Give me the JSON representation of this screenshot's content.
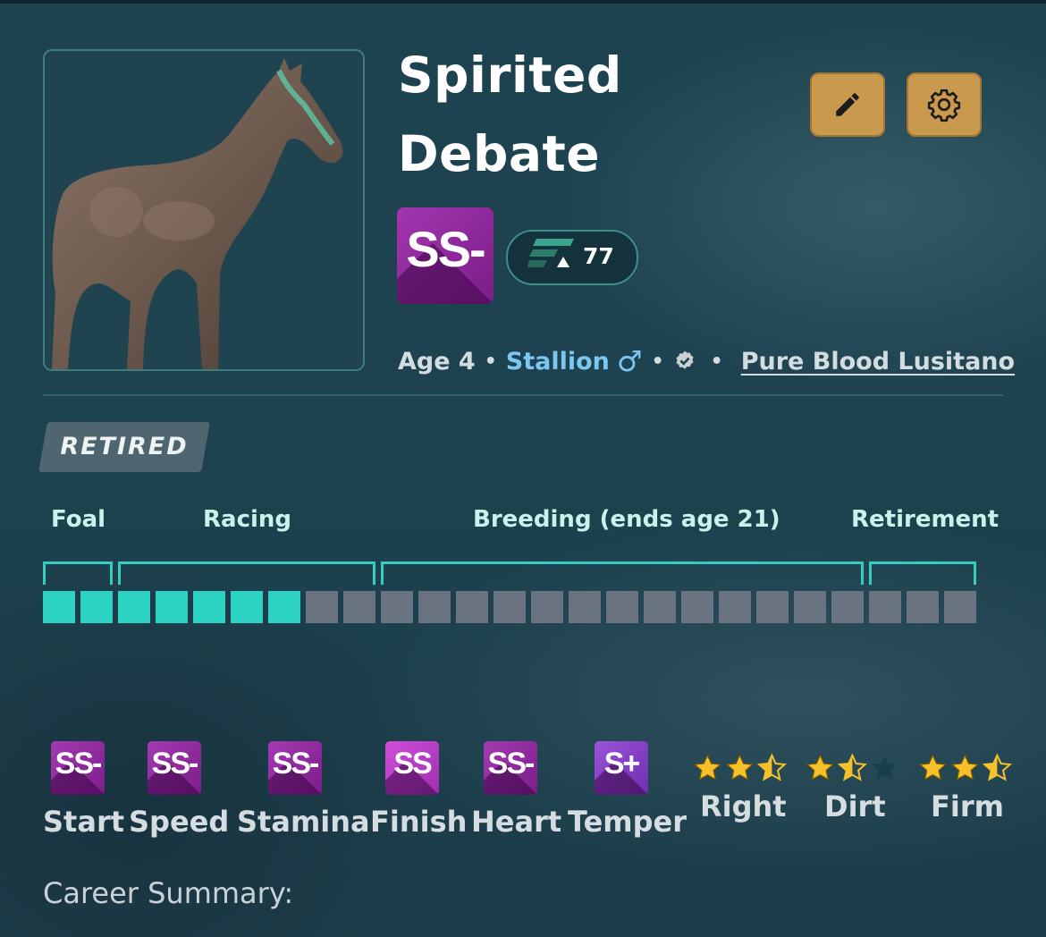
{
  "horse": {
    "name_line1": "Spirited",
    "name_line2": "Debate",
    "grade": "SS-",
    "rating": "77",
    "age": "Age 4",
    "sex": "Stallion",
    "sex_symbol": "♂",
    "breed": "Pure Blood Lusitano",
    "status": "RETIRED"
  },
  "actions": {
    "edit_icon": "pencil-icon",
    "settings_icon": "gear-icon"
  },
  "lifecycle": {
    "phases": [
      "Foal",
      "Racing",
      "Breeding (ends age 21)",
      "Retirement"
    ],
    "total_years": 25,
    "elapsed_years": 7
  },
  "stats": [
    {
      "label": "Start",
      "grade": "SS-"
    },
    {
      "label": "Speed",
      "grade": "SS-"
    },
    {
      "label": "Stamina",
      "grade": "SS-"
    },
    {
      "label": "Finish",
      "grade": "SS"
    },
    {
      "label": "Heart",
      "grade": "SS-"
    },
    {
      "label": "Temper",
      "grade": "S+"
    }
  ],
  "preferences": [
    {
      "label": "Right",
      "stars": 2.5
    },
    {
      "label": "Dirt",
      "stars": 1.5
    },
    {
      "label": "Firm",
      "stars": 2.5
    }
  ],
  "section": {
    "career_summary": "Career Summary:"
  },
  "colors": {
    "accent_teal": "#2dd3c2",
    "grade_purple": "#a236b0",
    "button_gold": "#c99a4e",
    "star_gold": "#f5c02a",
    "stallion_blue": "#7bc7f2"
  }
}
